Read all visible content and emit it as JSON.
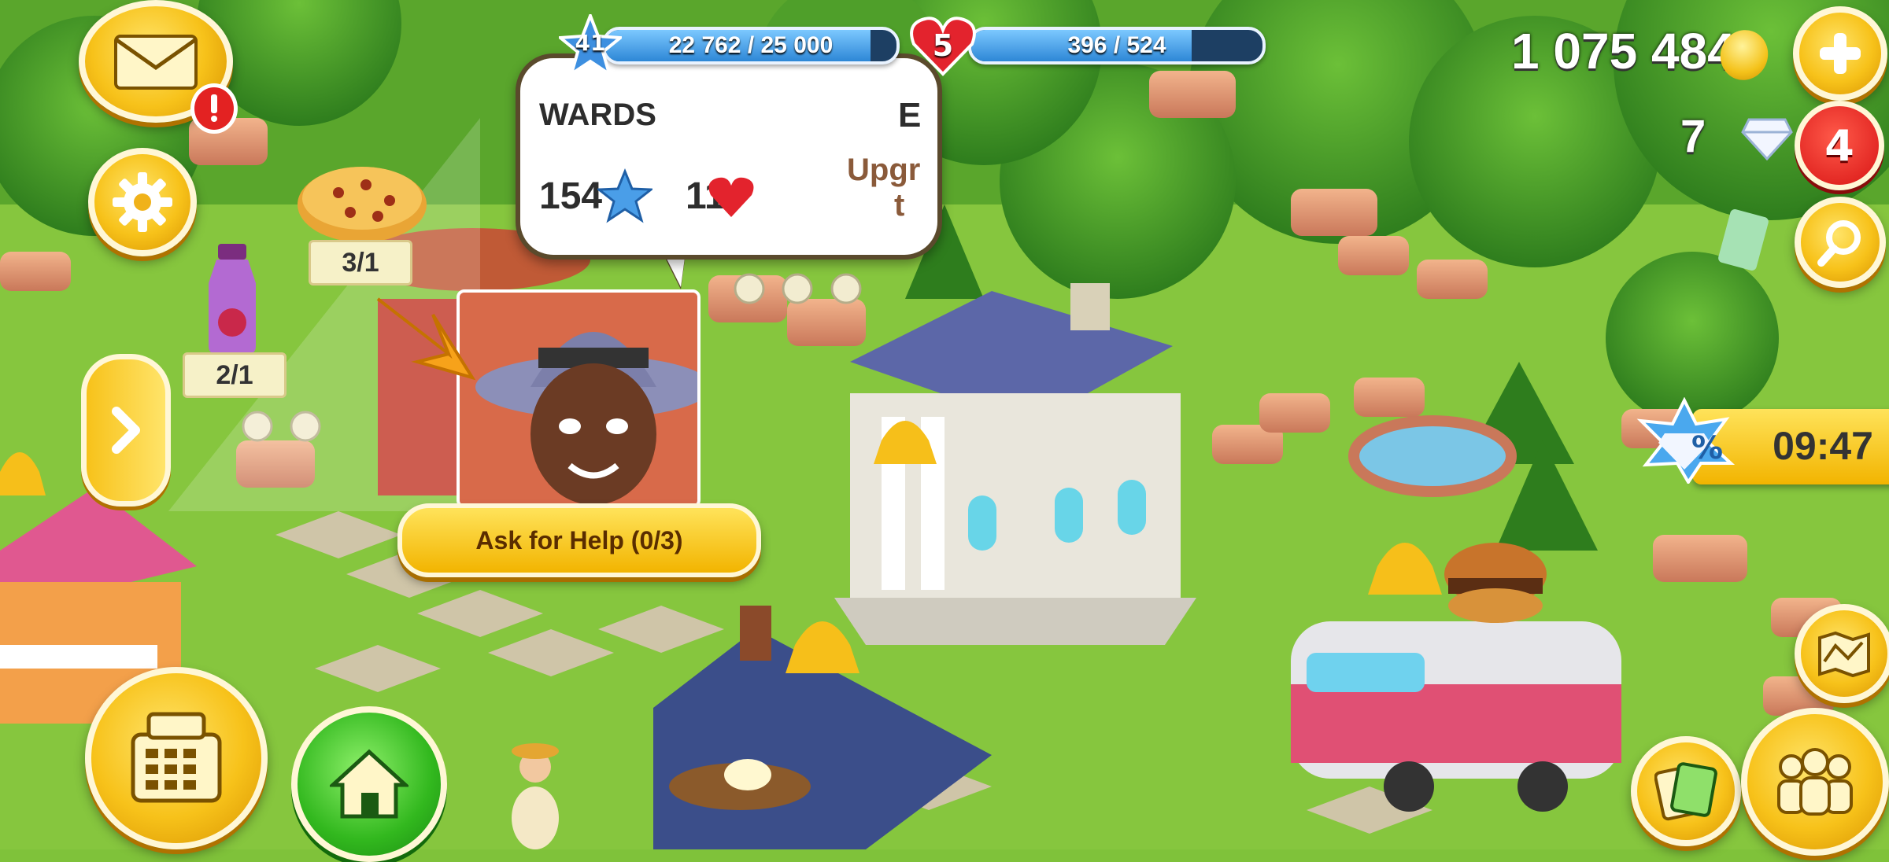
{
  "hud": {
    "level": "41",
    "xp_text": "22 762 / 25 000",
    "xp_fill": 0.91,
    "hearts": "5",
    "town_xp_text": "396 / 524",
    "town_xp_fill": 0.756,
    "coins": "1 075 484",
    "diamonds": "7",
    "notification_count": "4",
    "sale_timer": "09:47"
  },
  "tooltip": {
    "title": "WARDS",
    "stars": "154",
    "hearts": "11",
    "side_text_1": "Upgr",
    "side_text_2": "t",
    "side_letter": "E"
  },
  "visitor": {
    "order_items": [
      {
        "name": "cookie",
        "qty": "3/1"
      },
      {
        "name": "juice",
        "qty": "2/1"
      }
    ],
    "ask_help_label": "Ask for Help (0/3)"
  },
  "icons": {
    "mail": "envelope-icon",
    "settings": "gear-icon",
    "expand": "chevron-right-icon",
    "shop": "cash-register-icon",
    "home": "home-icon",
    "add": "plus-icon",
    "search": "magnifier-icon",
    "map": "map-icon",
    "friends": "people-icon",
    "cards": "cards-icon"
  },
  "colors": {
    "gold": "#f7c21a",
    "grass": "#7fc23a",
    "bar": "#1d3f63",
    "alert": "#e32222"
  }
}
